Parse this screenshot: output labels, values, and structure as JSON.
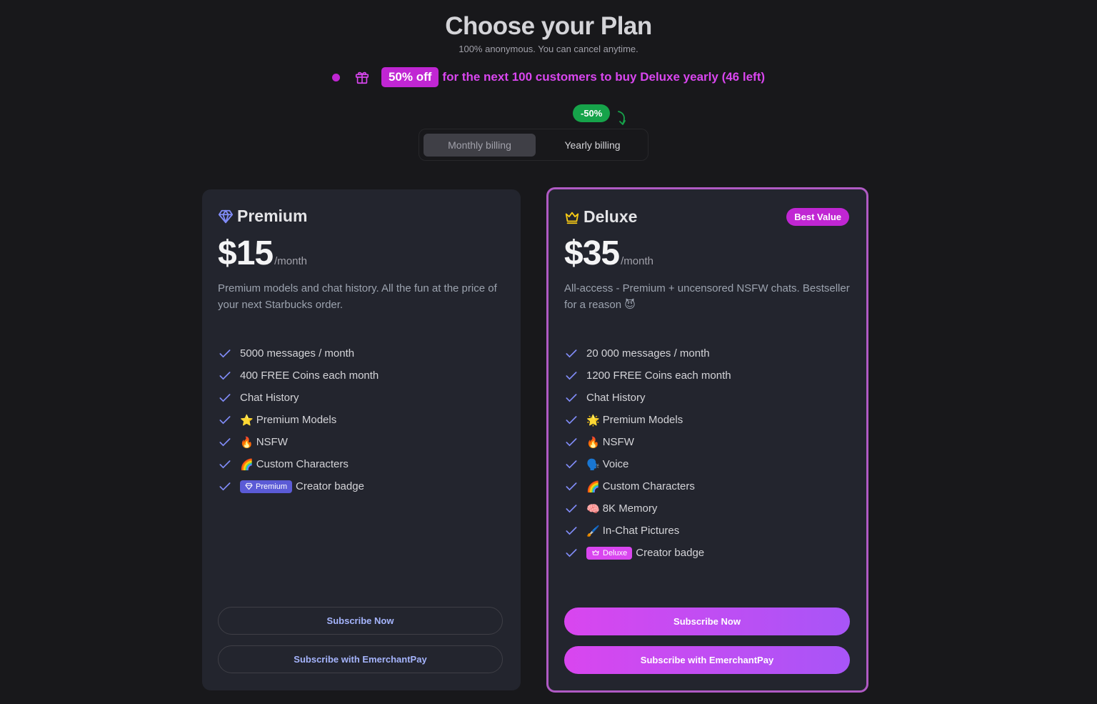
{
  "header": {
    "title": "Choose your Plan",
    "subtitle": "100% anonymous. You can cancel anytime."
  },
  "promo": {
    "badge": "50% off",
    "text": "for the next 100 customers to buy Deluxe yearly (46 left)",
    "icon": "gift-icon"
  },
  "billing": {
    "discount_label": "-50%",
    "monthly_label": "Monthly billing",
    "yearly_label": "Yearly billing",
    "selected": "monthly"
  },
  "plans": [
    {
      "name": "Premium",
      "icon": "diamond-icon",
      "price": "$15",
      "per": "/month",
      "description": "Premium models and chat history. All the fun at the price of your next Starbucks order.",
      "features": [
        {
          "emoji": "",
          "text": "5000 messages / month"
        },
        {
          "emoji": "",
          "text": "400 FREE Coins each month"
        },
        {
          "emoji": "",
          "text": "Chat History"
        },
        {
          "emoji": "⭐",
          "text": "Premium Models"
        },
        {
          "emoji": "🔥",
          "text": "NSFW"
        },
        {
          "emoji": "🌈",
          "text": "Custom Characters"
        }
      ],
      "creator_badge_label": "Premium",
      "creator_badge_text": "Creator badge",
      "subscribe_label": "Subscribe Now",
      "subscribe_alt_label": "Subscribe with EmerchantPay"
    },
    {
      "name": "Deluxe",
      "icon": "crown-icon",
      "tag": "Best Value",
      "price": "$35",
      "per": "/month",
      "description": "All-access - Premium + uncensored NSFW chats. Bestseller for a reason 😈",
      "features": [
        {
          "emoji": "",
          "text": "20 000 messages / month"
        },
        {
          "emoji": "",
          "text": "1200 FREE Coins each month"
        },
        {
          "emoji": "",
          "text": "Chat History"
        },
        {
          "emoji": "🌟",
          "text": "Premium Models"
        },
        {
          "emoji": "🔥",
          "text": "NSFW"
        },
        {
          "emoji": "🗣️",
          "text": "Voice"
        },
        {
          "emoji": "🌈",
          "text": "Custom Characters"
        },
        {
          "emoji": "🧠",
          "text": "8K Memory"
        },
        {
          "emoji": "🖌️",
          "text": "In-Chat Pictures"
        }
      ],
      "creator_badge_label": "Deluxe",
      "creator_badge_text": "Creator badge",
      "subscribe_label": "Subscribe Now",
      "subscribe_alt_label": "Subscribe with EmerchantPay"
    }
  ],
  "colors": {
    "background": "#18181b",
    "card": "#23252e",
    "accent_pink": "#d946ef",
    "accent_indigo": "#818cf8",
    "discount_green": "#16a34a"
  }
}
